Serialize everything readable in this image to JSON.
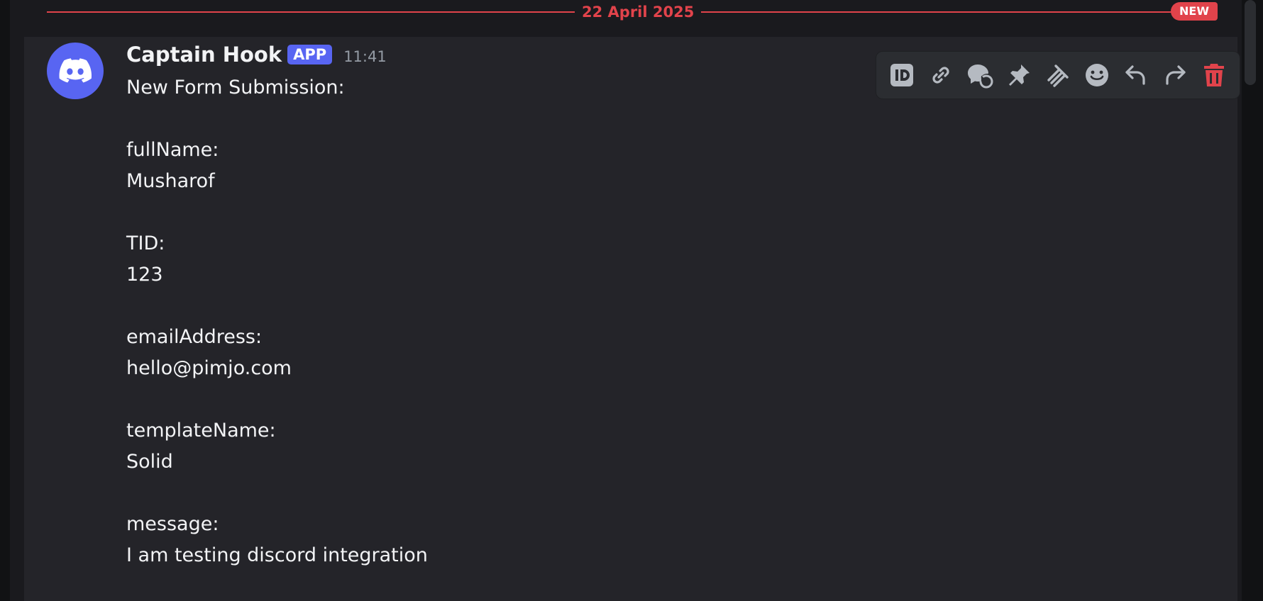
{
  "date_divider": {
    "date": "22 April 2025",
    "new_label": "NEW",
    "color": "#e1434b"
  },
  "message": {
    "author": "Captain Hook",
    "app_badge": "APP",
    "timestamp": "11:41",
    "avatar_icon": "discord-logo-icon",
    "avatar_color": "#5865f2",
    "lines": [
      "New Form Submission:",
      "",
      "fullName:",
      "Musharof",
      "",
      "TID:",
      "123",
      "",
      "emailAddress:",
      "hello@pimjo.com",
      "",
      "templateName:",
      "Solid",
      "",
      "message:",
      "I am testing discord integration"
    ]
  },
  "toolbar": {
    "buttons": [
      {
        "name": "copy-id-button",
        "icon": "id-icon"
      },
      {
        "name": "copy-link-button",
        "icon": "link-icon"
      },
      {
        "name": "mark-unread-button",
        "icon": "chat-unread-icon"
      },
      {
        "name": "pin-button",
        "icon": "pin-icon"
      },
      {
        "name": "thread-button",
        "icon": "thread-icon"
      },
      {
        "name": "add-reaction-button",
        "icon": "smiley-icon"
      },
      {
        "name": "reply-button",
        "icon": "reply-icon"
      },
      {
        "name": "forward-button",
        "icon": "forward-icon"
      },
      {
        "name": "delete-button",
        "icon": "trash-icon",
        "color": "#e1434b"
      }
    ]
  }
}
